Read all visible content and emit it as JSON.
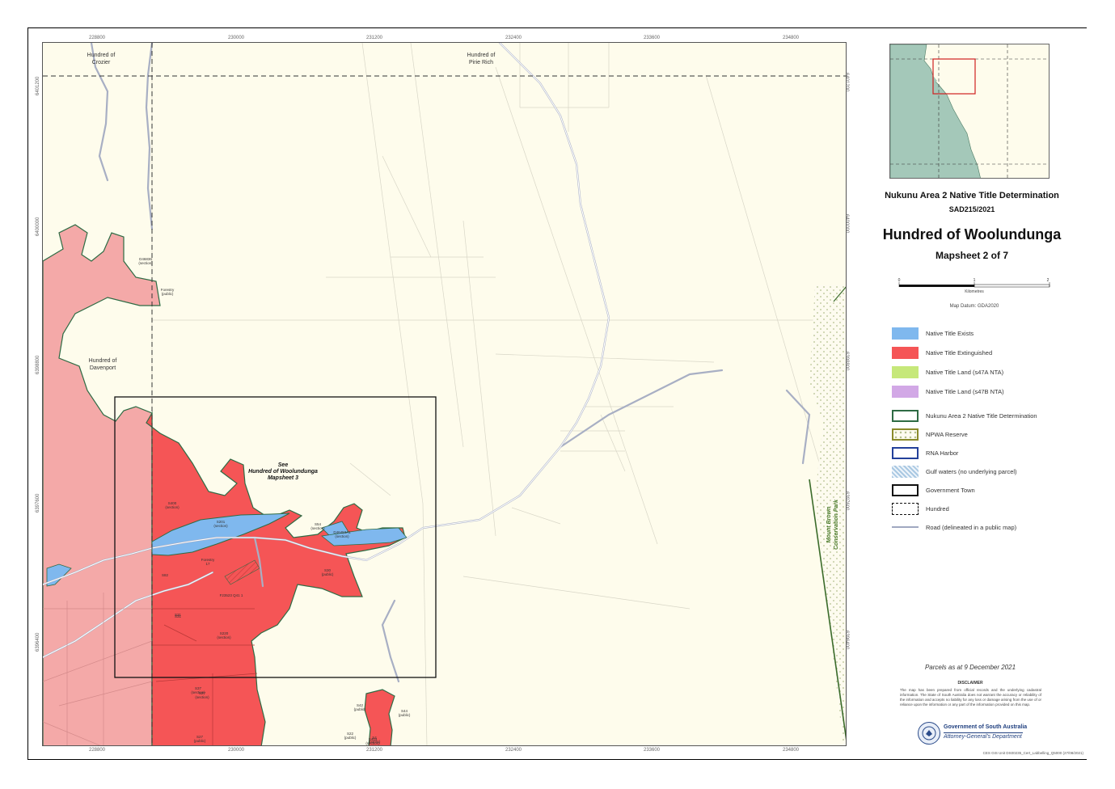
{
  "map": {
    "hundreds": {
      "crozier": "Hundred of\nCrozier",
      "pirie": "Hundred of\nPirie Rich",
      "davenport": "Hundred of\nDavenport"
    },
    "see_label": "See\nHundred of Woolundunga\nMapsheet 3",
    "park_label": "Mount Brown\nConservation Park",
    "parcel_labels": [
      "D46836\n(section)",
      "Forestry\n(public)",
      "S400\n(section)",
      "S201\n(section)",
      "S54\n(section)",
      "D46453A1\n(section)",
      "Forestry\n17",
      "S82",
      "S31",
      "S30\n(public)",
      "F23523 Q41 1\n",
      "S31",
      "S220\n(section)",
      "S27\n(section)",
      "S27\n(public)",
      "S42\n(public)",
      "S44\n(public)",
      "S22\n(public)",
      "S4\n(public)",
      "S403\n(section)",
      "S37\n(section)"
    ],
    "tick_top": [
      "228800",
      "230000",
      "231200",
      "232400",
      "233600",
      "234800"
    ],
    "tick_bottom": [
      "228800",
      "230000",
      "231200",
      "232400",
      "233600",
      "234800"
    ],
    "tick_left": [
      "6401200",
      "6400000",
      "6398800",
      "6397600",
      "6396400"
    ],
    "tick_right": [
      "6401200",
      "6400000",
      "6398800",
      "6397600",
      "6396400"
    ]
  },
  "panel": {
    "determination_title": "Nukunu Area 2 Native Title Determination",
    "determination_code": "SAD215/2021",
    "map_title": "Hundred of Woolundunga",
    "mapsheet": "Mapsheet 2 of 7",
    "scale": {
      "ticks": [
        "0",
        "1",
        "2"
      ],
      "units": "Kilometres"
    },
    "datum": "Map Datum: GDA2020"
  },
  "legend": [
    {
      "label": "Native Title Exists",
      "color": "#7fb8ee",
      "kind": "fill"
    },
    {
      "label": "Native Title Extinguished",
      "color": "#f55556",
      "kind": "fill"
    },
    {
      "label": "Native Title Land (s47A NTA)",
      "color": "#c6e87a",
      "kind": "fill"
    },
    {
      "label": "Native Title Land (s47B NTA)",
      "color": "#d2a8e6",
      "kind": "fill"
    },
    {
      "label": "Nukunu Area 2 Native Title Determination",
      "color": "#2e6b44",
      "kind": "outline"
    },
    {
      "label": "NPWA Reserve",
      "color": "#8a8a2a",
      "kind": "dots"
    },
    {
      "label": "RNA Harbor",
      "color": "#23409a",
      "kind": "outline"
    },
    {
      "label": "Gulf waters (no underlying parcel)",
      "color": "#a9c8e2",
      "kind": "hatch"
    },
    {
      "label": "Government Town",
      "color": "#111111",
      "kind": "outline"
    },
    {
      "label": "Hundred",
      "color": "#111111",
      "kind": "dashed"
    },
    {
      "label": "Road (delineated in a public map)",
      "color": "#a0a8c0",
      "kind": "line"
    }
  ],
  "parcels_date": "Parcels as at 9 December 2021",
  "disclaimer": {
    "heading": "DISCLAIMER",
    "body": "The map has been prepared from official records and the underlying cadastral information. The State of South Australia does not warrant the accuracy or reliability of the information and accepts no liability for any loss or damage arising from the use of or reliance upon the information or any part of the information provided on this map."
  },
  "government": {
    "name": "Government of South Australia",
    "dept": "Attorney-General's Department"
  },
  "file_ref": "CES GIS Unit DS00235_Cert_Labbelling_Q5000 (27/08/2021)"
}
